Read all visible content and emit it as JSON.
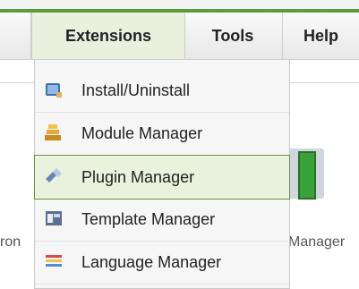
{
  "menubar": {
    "items": [
      {
        "label": "Extensions"
      },
      {
        "label": "Tools"
      },
      {
        "label": "Help"
      }
    ]
  },
  "dropdown": {
    "items": [
      {
        "label": "Install/Uninstall",
        "icon": "install-icon"
      },
      {
        "label": "Module Manager",
        "icon": "module-icon"
      },
      {
        "label": "Plugin Manager",
        "icon": "plugin-icon",
        "highlighted": true
      },
      {
        "label": "Template Manager",
        "icon": "template-icon"
      },
      {
        "label": "Language Manager",
        "icon": "language-icon"
      }
    ]
  },
  "background": {
    "left_fragment": "ron",
    "right_fragment": "Manager"
  },
  "colors": {
    "accent_green": "#5b9c3a",
    "hover_bg": "#e8f2dc",
    "hover_border": "#6b8f45"
  }
}
